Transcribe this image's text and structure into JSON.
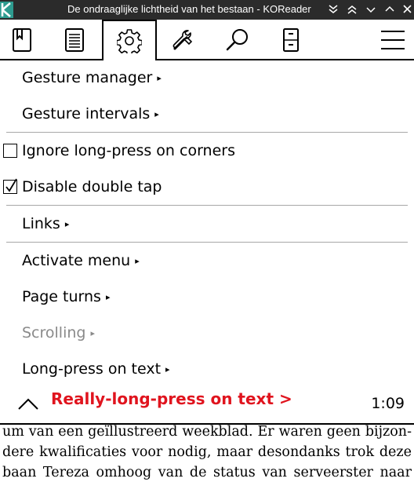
{
  "window": {
    "title": "De ondraaglijke lichtheid van het bestaan - KOReader",
    "icons": [
      "koreader-logo-icon",
      "collapse-icon",
      "double-chevron-up-icon",
      "chevron-down-icon",
      "chevron-up-icon",
      "close-icon"
    ]
  },
  "toolbar": {
    "tabs": [
      {
        "name": "bookmark-icon"
      },
      {
        "name": "table-of-contents-icon"
      },
      {
        "name": "settings-gear-icon",
        "active": true
      },
      {
        "name": "tools-icon"
      },
      {
        "name": "search-icon"
      },
      {
        "name": "filemanager-cabinet-icon"
      },
      {
        "name": "hamburger-menu-icon"
      }
    ]
  },
  "menu": {
    "items": [
      {
        "label": "Gesture manager",
        "submenu": true
      },
      {
        "label": "Gesture intervals",
        "submenu": true
      },
      {
        "label": "Ignore long-press on corners",
        "checked": false
      },
      {
        "label": "Disable double tap",
        "checked": true
      },
      {
        "label": "Links",
        "submenu": true
      },
      {
        "label": "Activate menu",
        "submenu": true
      },
      {
        "label": "Page turns",
        "submenu": true
      },
      {
        "label": "Scrolling",
        "submenu": true,
        "disabled": true
      },
      {
        "label": "Long-press on text",
        "submenu": true
      }
    ],
    "footer": {
      "title": "Really-long-press on text >",
      "page": "1:09"
    },
    "submenu_arrow": "▸"
  },
  "book": {
    "lines": [
      "um van een geïllustreerd weekblad. Er waren geen bijzon-",
      "dere kwalificaties voor nodig, maar desondanks trok deze",
      "baan Tereza omhoog van de status van serveerster naar"
    ]
  },
  "colors": {
    "titlebar": "#2b2b2b",
    "accent_logo": "#2e9b8f",
    "footer_title": "#e0141e",
    "disabled": "#8a8a8a"
  }
}
